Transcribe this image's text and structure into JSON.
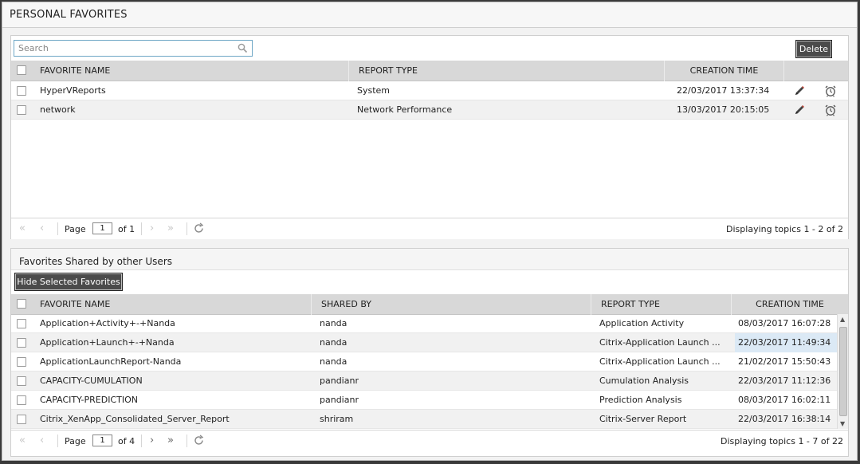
{
  "window": {
    "title": "PERSONAL FAVORITES"
  },
  "personal": {
    "search_placeholder": "Search",
    "delete_label": "Delete",
    "columns": {
      "name": "FAVORITE NAME",
      "type": "REPORT TYPE",
      "time": "CREATION TIME"
    },
    "rows": [
      {
        "name": "HyperVReports",
        "type": "System",
        "time": "22/03/2017 13:37:34"
      },
      {
        "name": "network",
        "type": "Network Performance",
        "time": "13/03/2017 20:15:05"
      }
    ],
    "pager": {
      "page_label": "Page",
      "page": "1",
      "of": "of 1",
      "display": "Displaying topics 1 - 2 of 2"
    }
  },
  "shared": {
    "title": "Favorites Shared by other Users",
    "hide_label": "Hide Selected Favorites",
    "columns": {
      "name": "FAVORITE NAME",
      "by": "SHARED BY",
      "type": "REPORT TYPE",
      "time": "CREATION TIME"
    },
    "rows": [
      {
        "name": "Application+Activity+-+Nanda",
        "by": "nanda",
        "type": "Application Activity",
        "time": "08/03/2017 16:07:28"
      },
      {
        "name": "Application+Launch+-+Nanda",
        "by": "nanda",
        "type": "Citrix-Application Launch ...",
        "time": "22/03/2017 11:49:34"
      },
      {
        "name": "ApplicationLaunchReport-Nanda",
        "by": "nanda",
        "type": "Citrix-Application Launch ...",
        "time": "21/02/2017 15:50:43"
      },
      {
        "name": "CAPACITY-CUMULATION",
        "by": "pandianr",
        "type": "Cumulation Analysis",
        "time": "22/03/2017 11:12:36"
      },
      {
        "name": "CAPACITY-PREDICTION",
        "by": "pandianr",
        "type": "Prediction Analysis",
        "time": "08/03/2017 16:02:11"
      },
      {
        "name": "Citrix_XenApp_Consolidated_Server_Report",
        "by": "shriram",
        "type": "Citrix-Server Report",
        "time": "22/03/2017 16:38:14"
      }
    ],
    "pager": {
      "page_label": "Page",
      "page": "1",
      "of": "of 4",
      "display": "Displaying topics 1 - 7 of 22"
    }
  },
  "colors": {
    "accent_border": "#6fa7c6",
    "header_bg": "#d8d8d8",
    "button_bg": "#4b4b4b",
    "highlight": "#dbe9f5"
  }
}
